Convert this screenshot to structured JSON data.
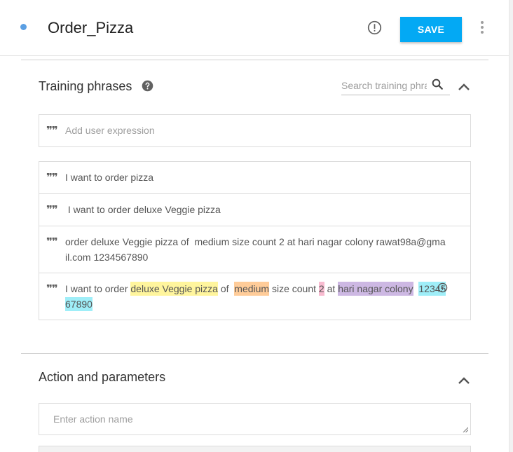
{
  "header": {
    "intent_name": "Order_Pizza",
    "save_label": "SAVE",
    "info_icon": "exclamation-circle-icon",
    "more_icon": "vertical-ellipsis-icon",
    "dot_color": "#5b9fe3",
    "save_color": "#03a9f4"
  },
  "training": {
    "title": "Training phrases",
    "help_icon": "question-circle-icon",
    "search_placeholder": "Search training phrases",
    "search_icon": "magnifier-icon",
    "collapse_icon": "chevron-up-icon",
    "add_placeholder": "Add user expression",
    "quote_glyph": "❞❞",
    "phrases": [
      {
        "text": "I want to order pizza"
      },
      {
        "text": " I want to order deluxe Veggie pizza"
      },
      {
        "text": "order deluxe Veggie pizza of  medium size count 2 at hari nagar colony rawat98a@gmail.com 1234567890"
      },
      {
        "segments": [
          {
            "text": "I want to order ",
            "hl": ""
          },
          {
            "text": "deluxe Veggie pizza",
            "hl": "yellow"
          },
          {
            "text": " of  ",
            "hl": ""
          },
          {
            "text": "medium",
            "hl": "orange"
          },
          {
            "text": " size count ",
            "hl": ""
          },
          {
            "text": "2",
            "hl": "pink"
          },
          {
            "text": " at ",
            "hl": ""
          },
          {
            "text": "hari nagar colony",
            "hl": "purple"
          },
          {
            "text": "  ",
            "hl": ""
          },
          {
            "text": "1234567890",
            "hl": "cyan"
          }
        ]
      }
    ]
  },
  "action": {
    "title": "Action and parameters",
    "collapse_icon": "chevron-up-icon",
    "action_placeholder": "Enter action name"
  }
}
